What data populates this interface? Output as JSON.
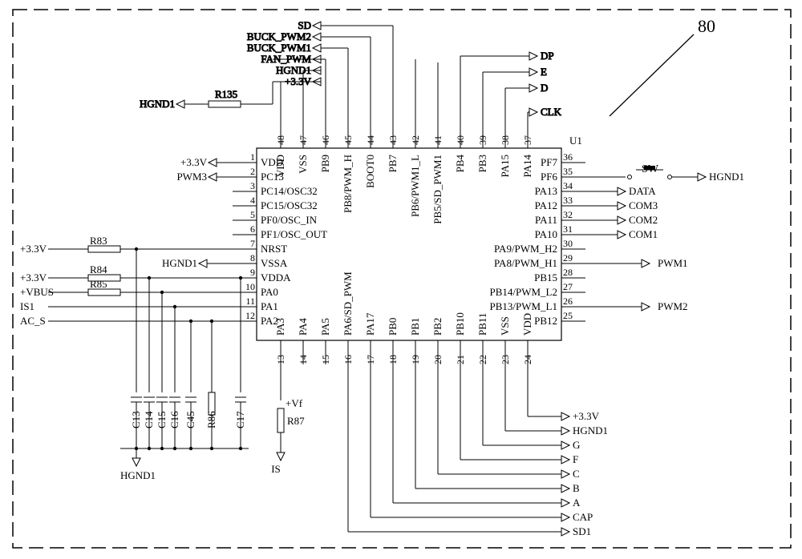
{
  "chip": {
    "ref": "U1",
    "left": [
      {
        "num": "1",
        "name": "VDD"
      },
      {
        "num": "2",
        "name": "PC13"
      },
      {
        "num": "3",
        "name": "PC14/OSC32"
      },
      {
        "num": "4",
        "name": "PC15/OSC32"
      },
      {
        "num": "5",
        "name": "PF0/OSC_IN"
      },
      {
        "num": "6",
        "name": "PF1/OSC_OUT"
      },
      {
        "num": "7",
        "name": "NRST"
      },
      {
        "num": "8",
        "name": "VSSA"
      },
      {
        "num": "9",
        "name": "VDDA"
      },
      {
        "num": "10",
        "name": "PA0"
      },
      {
        "num": "11",
        "name": "PA1"
      },
      {
        "num": "12",
        "name": "PA2"
      }
    ],
    "right": [
      {
        "num": "36",
        "name": "PF7"
      },
      {
        "num": "35",
        "name": "PF6"
      },
      {
        "num": "34",
        "name": "PA13"
      },
      {
        "num": "33",
        "name": "PA12"
      },
      {
        "num": "32",
        "name": "PA11"
      },
      {
        "num": "31",
        "name": "PA10"
      },
      {
        "num": "30",
        "name": "PA9/PWM_H2"
      },
      {
        "num": "29",
        "name": "PA8/PWM_H1"
      },
      {
        "num": "28",
        "name": "PB15"
      },
      {
        "num": "27",
        "name": "PB14/PWM_L2"
      },
      {
        "num": "26",
        "name": "PB13/PWM_L1"
      },
      {
        "num": "25",
        "name": "PB12"
      }
    ],
    "top": [
      {
        "num": "48",
        "name": "VDD"
      },
      {
        "num": "47",
        "name": "VSS"
      },
      {
        "num": "46",
        "name": "PB9"
      },
      {
        "num": "45",
        "name": "PB8/PWM_H"
      },
      {
        "num": "44",
        "name": "BOOT0"
      },
      {
        "num": "43",
        "name": "PB7"
      },
      {
        "num": "42",
        "name": "PB6/PWM1_L"
      },
      {
        "num": "41",
        "name": "PB5/SD_PWM1"
      },
      {
        "num": "40",
        "name": "PB4"
      },
      {
        "num": "39",
        "name": "PB3"
      },
      {
        "num": "38",
        "name": "PA15"
      },
      {
        "num": "37",
        "name": "PA14"
      }
    ],
    "bottom": [
      {
        "num": "13",
        "name": "PA3"
      },
      {
        "num": "14",
        "name": "PA4"
      },
      {
        "num": "15",
        "name": "PA5"
      },
      {
        "num": "16",
        "name": "PA6/SD_PWM"
      },
      {
        "num": "17",
        "name": "PA17"
      },
      {
        "num": "18",
        "name": "PB0"
      },
      {
        "num": "19",
        "name": "PB1"
      },
      {
        "num": "20",
        "name": "PB2"
      },
      {
        "num": "21",
        "name": "PB10"
      },
      {
        "num": "22",
        "name": "PB11"
      },
      {
        "num": "23",
        "name": "VSS"
      },
      {
        "num": "24",
        "name": "VDD"
      }
    ]
  },
  "nets": {
    "block_ref": "80",
    "sw": "SW",
    "left_power1": "+3.3V",
    "left_pwm3": "PWM3",
    "left_v33a": "+3.3V",
    "left_v33b": "+3.3V",
    "left_vbus": "+VBUS",
    "left_is1": "IS1",
    "left_acs": "AC_S",
    "r83": "R83",
    "r84": "R84",
    "r85": "R85",
    "r86": "R86",
    "r87": "R87",
    "r135": "R135",
    "c13": "C13",
    "c14": "C14",
    "c15": "C15",
    "c16": "C16",
    "c17": "C17",
    "c45": "C45",
    "hgnd1": "HGND1",
    "vf": "+Vf",
    "is": "IS",
    "top_sd": "SD",
    "top_bpwm2": "BUCK_PWM2",
    "top_bpwm1": "BUCK_PWM1",
    "top_fan": "FAN_PWM",
    "top_hgnd": "HGND1",
    "top_v33": "+3.3V",
    "top_hgnd1b": "HGND1",
    "top_dp": "DP",
    "top_e": "E",
    "top_d": "D",
    "top_clk": "CLK",
    "right_hgnd1": "HGND1",
    "right_data": "DATA",
    "right_com3": "COM3",
    "right_com2": "COM2",
    "right_com1": "COM1",
    "right_pwm1": "PWM1",
    "right_pwm2": "PWM2",
    "btm_v33": "+3.3V",
    "btm_hgnd": "HGND1",
    "btm_g": "G",
    "btm_f": "F",
    "btm_c": "C",
    "btm_b": "B",
    "btm_a": "A",
    "btm_cap": "CAP",
    "btm_sd1": "SD1"
  }
}
